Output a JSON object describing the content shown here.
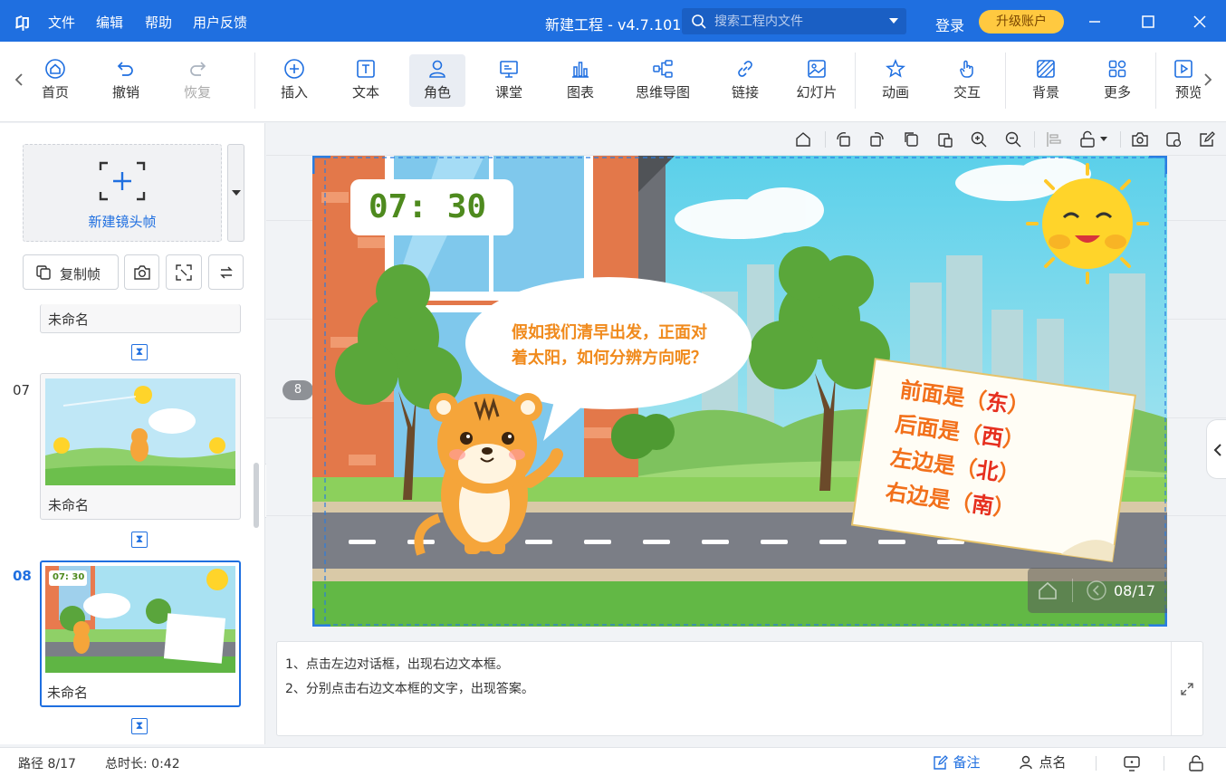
{
  "app": {
    "logo": "卬",
    "menus": [
      "文件",
      "编辑",
      "帮助",
      "用户反馈"
    ],
    "title": "新建工程 - v4.7.101",
    "search_placeholder": "搜索工程内文件",
    "login": "登录",
    "upgrade": "升级账户"
  },
  "toolbar": {
    "items": [
      {
        "label": "首页",
        "icon": "home-icon"
      },
      {
        "label": "撤销",
        "icon": "undo-icon"
      },
      {
        "label": "恢复",
        "icon": "redo-icon"
      },
      {
        "label": "插入",
        "icon": "plus-circle-icon"
      },
      {
        "label": "文本",
        "icon": "text-icon"
      },
      {
        "label": "角色",
        "icon": "character-icon"
      },
      {
        "label": "课堂",
        "icon": "classroom-icon"
      },
      {
        "label": "图表",
        "icon": "chart-icon"
      },
      {
        "label": "思维导图",
        "icon": "mindmap-icon"
      },
      {
        "label": "链接",
        "icon": "link-icon"
      },
      {
        "label": "幻灯片",
        "icon": "slide-icon"
      },
      {
        "label": "动画",
        "icon": "star-icon"
      },
      {
        "label": "交互",
        "icon": "hand-icon"
      },
      {
        "label": "背景",
        "icon": "background-icon"
      },
      {
        "label": "更多",
        "icon": "grid-icon"
      },
      {
        "label": "预览",
        "icon": "preview-icon"
      }
    ]
  },
  "left": {
    "new_frame": "新建镜头帧",
    "copy_frame": "复制帧",
    "frames": [
      {
        "num": "",
        "name": "未命名"
      },
      {
        "num": "07",
        "name": "未命名"
      },
      {
        "num": "08",
        "name": "未命名",
        "selected": true
      }
    ],
    "thumb8_time": "07: 30"
  },
  "canvas": {
    "frame_badge": "8",
    "clock": "07: 30",
    "speech": [
      "假如我们清早出发，正面对",
      "着太阳，如何分辨方向呢？"
    ],
    "card": [
      {
        "prefix": "前面是",
        "answer": "东"
      },
      {
        "prefix": "后面是",
        "answer": "西"
      },
      {
        "prefix": "左边是",
        "answer": "北"
      },
      {
        "prefix": "右边是",
        "answer": "南"
      }
    ],
    "open_paren": "（",
    "close_paren": "）",
    "page_indicator": "08/17"
  },
  "notes": {
    "line1": "1、点击左边对话框，出现右边文本框。",
    "line2": "2、分别点击右边文本框的文字，出现答案。"
  },
  "status": {
    "path": "路径 8/17",
    "duration": "总时长: 0:42",
    "notes_btn": "备注",
    "rollcall_btn": "点名"
  }
}
